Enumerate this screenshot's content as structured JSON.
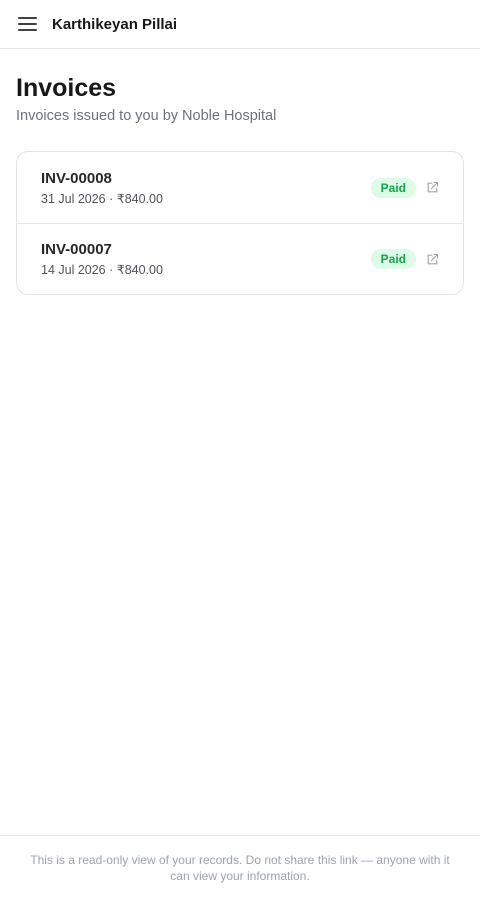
{
  "header": {
    "menu_icon": "hamburger-menu-icon",
    "user_name": "Karthikeyan Pillai"
  },
  "main": {
    "title": "Invoices",
    "subtitle": "Invoices issued to you by Noble Hospital"
  },
  "invoices": [
    {
      "number": "INV-00008",
      "meta": "31 Jul 2026 · ₹840.00",
      "status": "Paid",
      "action_icon": "external-link-icon"
    },
    {
      "number": "INV-00007",
      "meta": "14 Jul 2026 · ₹840.00",
      "status": "Paid",
      "action_icon": "external-link-icon"
    }
  ],
  "footer": {
    "notice": "This is a read-only view of your records. Do not share this link — anyone with it can view your information."
  },
  "colors": {
    "paid_badge_bg": "#dcfce7",
    "paid_badge_text": "#16a34a",
    "border": "#e4e4e7",
    "muted_text": "#6b7280"
  }
}
